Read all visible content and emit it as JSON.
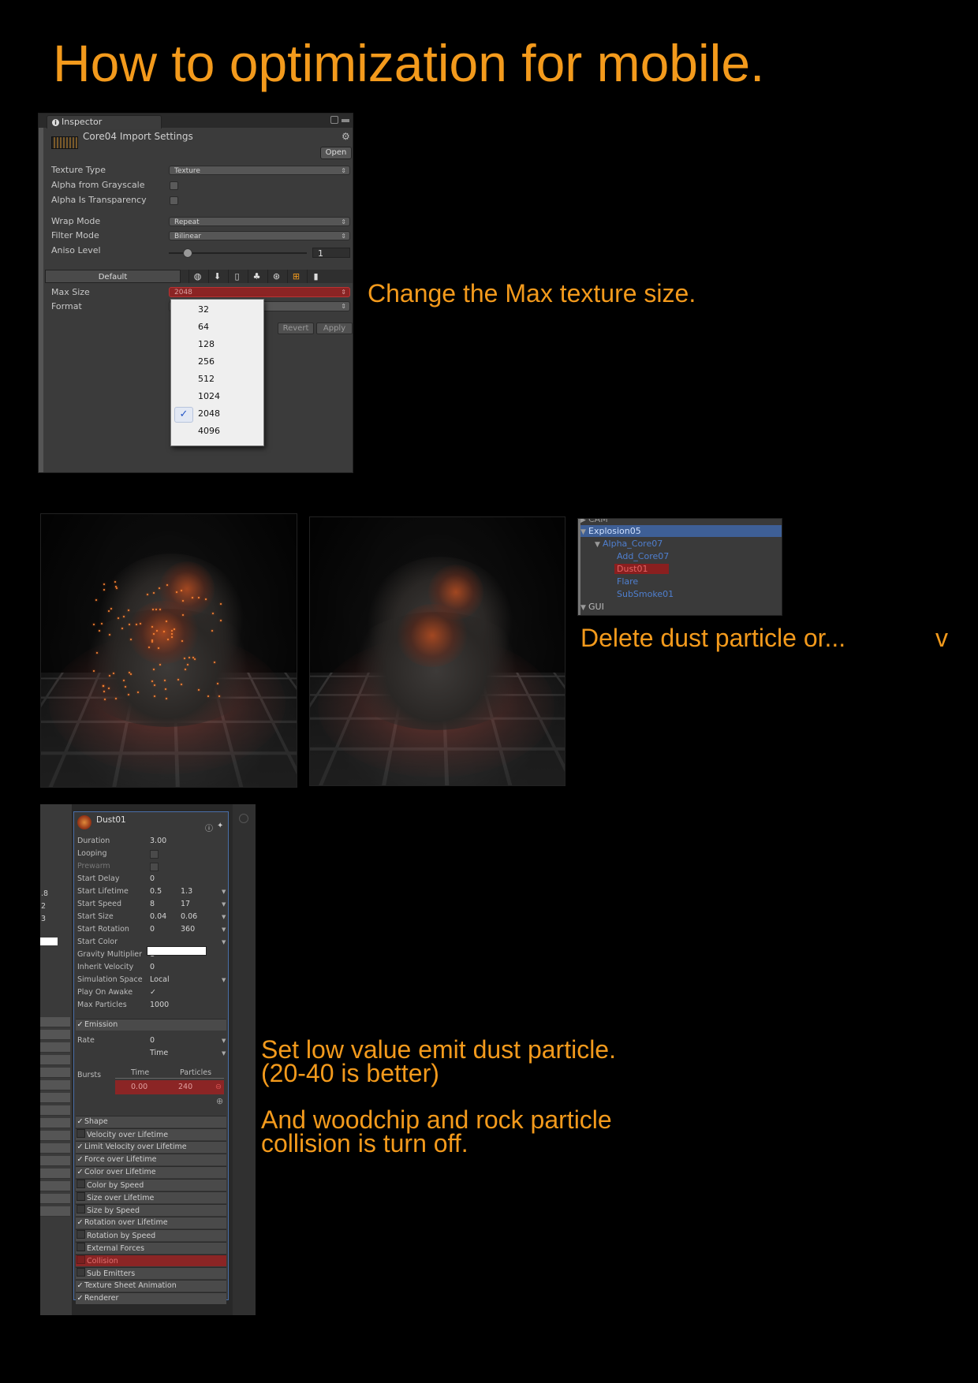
{
  "title": "How to optimization for mobile.",
  "captions": {
    "max_texture": "Change the Max texture size.",
    "delete_dust": "Delete dust particle or...",
    "delete_dust_suffix": "v",
    "low_emit_1": "Set low value emit dust particle.",
    "low_emit_2": "(20-40 is better)",
    "collision_1": "And woodchip and rock particle",
    "collision_2": "collision is turn off."
  },
  "inspector": {
    "tab_label": "Inspector",
    "asset_title": "Core04 Import Settings",
    "open_label": "Open",
    "fields": {
      "texture_type_label": "Texture Type",
      "texture_type_value": "Texture",
      "alpha_grayscale_label": "Alpha from Grayscale",
      "alpha_transparency_label": "Alpha Is Transparency",
      "wrap_mode_label": "Wrap Mode",
      "wrap_mode_value": "Repeat",
      "filter_mode_label": "Filter Mode",
      "filter_mode_value": "Bilinear",
      "aniso_label": "Aniso Level",
      "aniso_value": "1"
    },
    "default_tab": "Default",
    "platform_icons": [
      "globe-icon",
      "download-icon",
      "phone-icon",
      "android-icon",
      "blackberry-icon",
      "windows-icon",
      "device-icon"
    ],
    "max_size_label": "Max Size",
    "max_size_value": "2048",
    "format_label": "Format",
    "revert_label": "Revert",
    "apply_label": "Apply",
    "max_size_options": [
      "32",
      "64",
      "128",
      "256",
      "512",
      "1024",
      "2048",
      "4096"
    ],
    "max_size_selected": "2048"
  },
  "hierarchy": {
    "items": [
      {
        "label": "CAM"
      },
      {
        "label": "Explosion05"
      },
      {
        "label": "Alpha_Core07"
      },
      {
        "label": "Add_Core07"
      },
      {
        "label": "Dust01"
      },
      {
        "label": "Flare"
      },
      {
        "label": "SubSmoke01"
      },
      {
        "label": "GUI"
      }
    ],
    "selected": "Explosion05",
    "highlighted": "Dust01"
  },
  "particle": {
    "name": "Dust01",
    "left_stub_values": [
      ".8",
      "2",
      "3"
    ],
    "properties": [
      {
        "label": "Duration",
        "v1": "3.00",
        "v2": ""
      },
      {
        "label": "Looping",
        "v1": "",
        "v2": ""
      },
      {
        "label": "Prewarm",
        "v1": "",
        "v2": ""
      },
      {
        "label": "Start Delay",
        "v1": "0",
        "v2": ""
      },
      {
        "label": "Start Lifetime",
        "v1": "0.5",
        "v2": "1.3"
      },
      {
        "label": "Start Speed",
        "v1": "8",
        "v2": "17"
      },
      {
        "label": "Start Size",
        "v1": "0.04",
        "v2": "0.06"
      },
      {
        "label": "Start Rotation",
        "v1": "0",
        "v2": "360"
      },
      {
        "label": "Start Color",
        "v1": "",
        "v2": ""
      },
      {
        "label": "Gravity Multiplier",
        "v1": "1",
        "v2": ""
      },
      {
        "label": "Inherit Velocity",
        "v1": "0",
        "v2": ""
      },
      {
        "label": "Simulation Space",
        "v1": "Local",
        "v2": ""
      },
      {
        "label": "Play On Awake",
        "v1": "✓",
        "v2": ""
      },
      {
        "label": "Max Particles",
        "v1": "1000",
        "v2": ""
      }
    ],
    "emission": {
      "label": "Emission",
      "rate_label": "Rate",
      "rate_value": "0",
      "rate_mode": "Time",
      "bursts_label": "Bursts",
      "bursts_time_header": "Time",
      "bursts_particles_header": "Particles",
      "burst_time": "0.00",
      "burst_particles": "240"
    },
    "modules": [
      {
        "label": "Shape",
        "checked": true
      },
      {
        "label": "Velocity over Lifetime",
        "checked": false
      },
      {
        "label": "Limit Velocity over Lifetime",
        "checked": true
      },
      {
        "label": "Force over Lifetime",
        "checked": true
      },
      {
        "label": "Color over Lifetime",
        "checked": true
      },
      {
        "label": "Color by Speed",
        "checked": false
      },
      {
        "label": "Size over Lifetime",
        "checked": false
      },
      {
        "label": "Size by Speed",
        "checked": false
      },
      {
        "label": "Rotation over Lifetime",
        "checked": true
      },
      {
        "label": "Rotation by Speed",
        "checked": false
      },
      {
        "label": "External Forces",
        "checked": false
      },
      {
        "label": "Collision",
        "checked": false
      },
      {
        "label": "Sub Emitters",
        "checked": false
      },
      {
        "label": "Texture Sheet Animation",
        "checked": true
      },
      {
        "label": "Renderer",
        "checked": true
      }
    ]
  },
  "colors": {
    "accent": "#f39a1c",
    "highlight_red": "#8b2525",
    "selection_blue": "#3e5f96"
  }
}
